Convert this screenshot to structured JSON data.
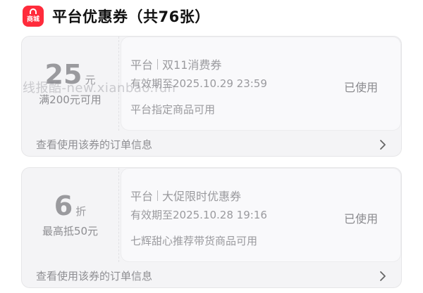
{
  "header": {
    "logo_text": "商城",
    "title": "平台优惠券（共76张）"
  },
  "coupons": [
    {
      "amount": "25",
      "unit": "元",
      "condition": "满200元可用",
      "source": "平台",
      "name": "双11消费券",
      "validity": "有效期至2025.10.29 23:59",
      "scope": "平台指定商品可用",
      "status": "已使用",
      "footer": "查看使用该券的订单信息"
    },
    {
      "amount": "6",
      "unit": "折",
      "condition": "最高抵50元",
      "source": "平台",
      "name": "大促限时优惠券",
      "validity": "有效期至2025.10.28 19:16",
      "scope": "七辉甜心推荐带货商品可用",
      "status": "已使用",
      "footer": "查看使用该券的订单信息"
    }
  ],
  "watermark": "线报酷-new.xianbao.fun",
  "icons": {
    "logo": "shopping-bag-icon",
    "footer_arrow": "chevron-right-icon"
  },
  "colors": {
    "brand": "#ff2b3b",
    "card_bg": "#f4f4f6",
    "muted_text": "#9a9a9e"
  }
}
